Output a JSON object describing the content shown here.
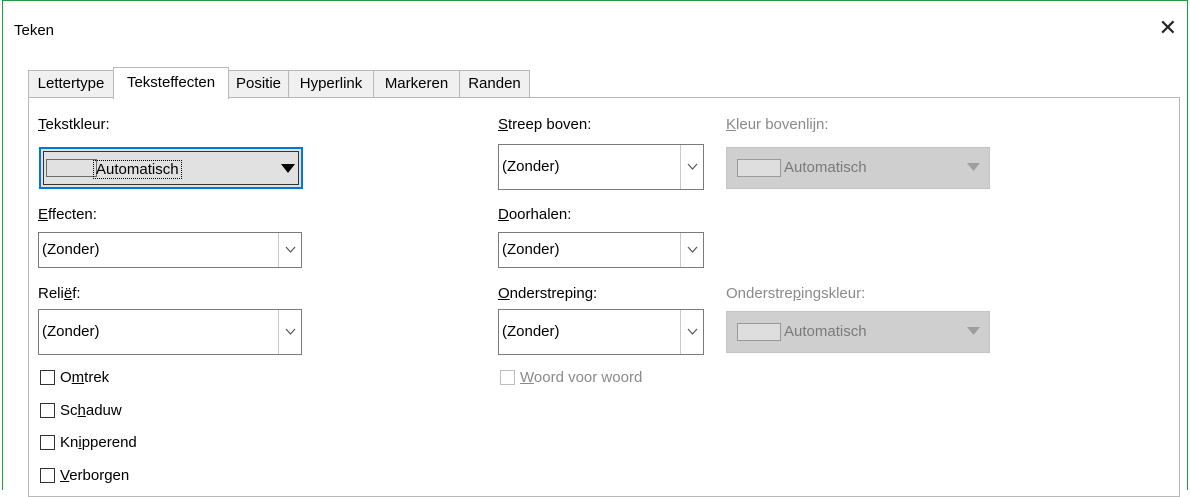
{
  "window": {
    "title": "Teken",
    "close_glyph": "✕"
  },
  "tabs": [
    {
      "label": "Lettertype"
    },
    {
      "label": "Teksteffecten"
    },
    {
      "label": "Positie"
    },
    {
      "label": "Hyperlink"
    },
    {
      "label": "Markeren"
    },
    {
      "label": "Randen"
    }
  ],
  "left": {
    "font_color": {
      "label_u": "T",
      "label_rest": "ekstkleur:",
      "value": "Automatisch"
    },
    "effects": {
      "label_u": "E",
      "label_rest": "ffecten:",
      "value": "(Zonder)"
    },
    "relief": {
      "label_pre": "Reli",
      "label_u": "ë",
      "label_rest": "f:",
      "value": "(Zonder)"
    },
    "checkboxes": [
      {
        "pre": "O",
        "u": "m",
        "post": "trek",
        "checked": false
      },
      {
        "pre": "Sc",
        "u": "h",
        "post": "aduw",
        "checked": false
      },
      {
        "pre": "Kn",
        "u": "i",
        "post": "pperend",
        "checked": false
      },
      {
        "pre": "",
        "u": "V",
        "post": "erborgen",
        "checked": false
      }
    ]
  },
  "middle": {
    "overline": {
      "label_u": "S",
      "label_rest": "treep boven:",
      "value": "(Zonder)"
    },
    "strikethrough": {
      "label_u": "D",
      "label_rest": "oorhalen:",
      "value": "(Zonder)"
    },
    "underline": {
      "label_u": "O",
      "label_rest": "nderstreping:",
      "value": "(Zonder)"
    },
    "word_by_word": {
      "pre": "",
      "u": "W",
      "post": "oord voor woord",
      "checked": false,
      "enabled": false
    }
  },
  "right": {
    "overline_color": {
      "label_u": "K",
      "label_rest": "leur bovenlijn:",
      "value": "Automatisch",
      "enabled": false
    },
    "underline_color": {
      "label_pre": "Onderstre",
      "label_u": "p",
      "label_rest": "ingskleur:",
      "value": "Automatisch",
      "enabled": false
    }
  },
  "icons": {
    "combo_arrow": "chevron-down-icon",
    "color_caret": "triangle-down-icon"
  }
}
